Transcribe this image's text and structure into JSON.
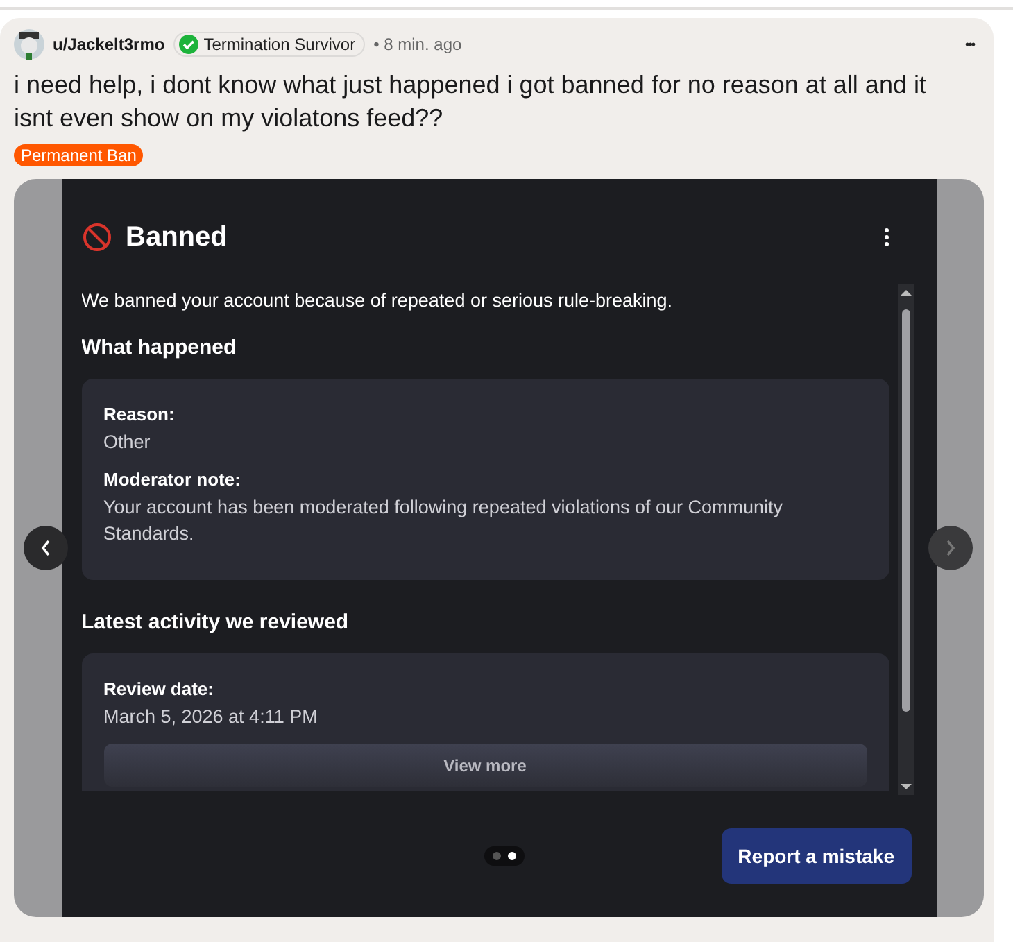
{
  "post": {
    "author": "u/Jackelt3rmo",
    "flair": "Termination Survivor",
    "time": "• 8 min. ago",
    "more": "•••",
    "title": "i need help, i dont know what just happened i got banned for no reason at all and it isnt even show on my violatons feed??",
    "tag": "Permanent Ban"
  },
  "carousel": {
    "dots": [
      {
        "selected": false
      },
      {
        "selected": true
      }
    ],
    "screen": {
      "heading": "Banned",
      "intro": "We banned your account because of repeated or serious rule-breaking.",
      "sections": [
        {
          "title": "What happened",
          "fields": [
            {
              "label": "Reason:",
              "value": "Other"
            },
            {
              "label": "Moderator note:",
              "value": "Your account has been moderated following repeated violations of our Community Standards."
            }
          ]
        },
        {
          "title": "Latest activity we reviewed",
          "fields": [
            {
              "label": "Review date:",
              "value": "March 5, 2026 at 4:11 PM"
            }
          ],
          "button": "View more"
        }
      ],
      "action": "Report a mistake"
    }
  }
}
